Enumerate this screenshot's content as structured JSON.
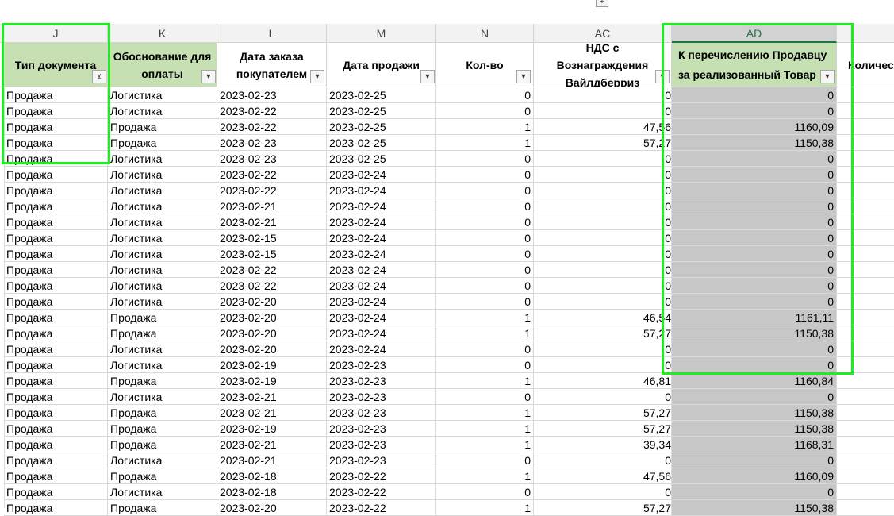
{
  "toolbar": {
    "expand_symbol": "+"
  },
  "columns": [
    {
      "letter": "J",
      "header": "Тип документа"
    },
    {
      "letter": "K",
      "header": "Обоснование для оплаты"
    },
    {
      "letter": "L",
      "header": "Дата заказа покупателем"
    },
    {
      "letter": "M",
      "header": "Дата продажи"
    },
    {
      "letter": "N",
      "header": "Кол-во"
    },
    {
      "letter": "AC",
      "header": "НДС с Вознаграждения Вайлдберриз"
    },
    {
      "letter": "AD",
      "header": "К перечислению Продавцу за реализованный Товар"
    },
    {
      "letter": "",
      "header": "Количес"
    }
  ],
  "filter_icon_active": "filter-active-icon",
  "filter_icon": "dropdown-arrow-icon",
  "colors": {
    "header_green": "#c6e0b4",
    "selection_gray": "#c7c7c7",
    "highlight_frame": "#1eee1e",
    "excel_green": "#217346"
  },
  "rows": [
    [
      "Продажа",
      "Логистика",
      "2023-02-23",
      "2023-02-25",
      "0",
      "0",
      "0"
    ],
    [
      "Продажа",
      "Логистика",
      "2023-02-22",
      "2023-02-25",
      "0",
      "0",
      "0"
    ],
    [
      "Продажа",
      "Продажа",
      "2023-02-22",
      "2023-02-25",
      "1",
      "47,56",
      "1160,09"
    ],
    [
      "Продажа",
      "Продажа",
      "2023-02-23",
      "2023-02-25",
      "1",
      "57,27",
      "1150,38"
    ],
    [
      "Продажа",
      "Логистика",
      "2023-02-23",
      "2023-02-25",
      "0",
      "0",
      "0"
    ],
    [
      "Продажа",
      "Логистика",
      "2023-02-22",
      "2023-02-24",
      "0",
      "0",
      "0"
    ],
    [
      "Продажа",
      "Логистика",
      "2023-02-22",
      "2023-02-24",
      "0",
      "0",
      "0"
    ],
    [
      "Продажа",
      "Логистика",
      "2023-02-21",
      "2023-02-24",
      "0",
      "0",
      "0"
    ],
    [
      "Продажа",
      "Логистика",
      "2023-02-21",
      "2023-02-24",
      "0",
      "0",
      "0"
    ],
    [
      "Продажа",
      "Логистика",
      "2023-02-15",
      "2023-02-24",
      "0",
      "0",
      "0"
    ],
    [
      "Продажа",
      "Логистика",
      "2023-02-15",
      "2023-02-24",
      "0",
      "0",
      "0"
    ],
    [
      "Продажа",
      "Логистика",
      "2023-02-22",
      "2023-02-24",
      "0",
      "0",
      "0"
    ],
    [
      "Продажа",
      "Логистика",
      "2023-02-22",
      "2023-02-24",
      "0",
      "0",
      "0"
    ],
    [
      "Продажа",
      "Логистика",
      "2023-02-20",
      "2023-02-24",
      "0",
      "0",
      "0"
    ],
    [
      "Продажа",
      "Продажа",
      "2023-02-20",
      "2023-02-24",
      "1",
      "46,54",
      "1161,11"
    ],
    [
      "Продажа",
      "Продажа",
      "2023-02-20",
      "2023-02-24",
      "1",
      "57,27",
      "1150,38"
    ],
    [
      "Продажа",
      "Логистика",
      "2023-02-20",
      "2023-02-24",
      "0",
      "0",
      "0"
    ],
    [
      "Продажа",
      "Логистика",
      "2023-02-19",
      "2023-02-23",
      "0",
      "0",
      "0"
    ],
    [
      "Продажа",
      "Продажа",
      "2023-02-19",
      "2023-02-23",
      "1",
      "46,81",
      "1160,84"
    ],
    [
      "Продажа",
      "Логистика",
      "2023-02-21",
      "2023-02-23",
      "0",
      "0",
      "0"
    ],
    [
      "Продажа",
      "Продажа",
      "2023-02-21",
      "2023-02-23",
      "1",
      "57,27",
      "1150,38"
    ],
    [
      "Продажа",
      "Продажа",
      "2023-02-19",
      "2023-02-23",
      "1",
      "57,27",
      "1150,38"
    ],
    [
      "Продажа",
      "Продажа",
      "2023-02-21",
      "2023-02-23",
      "1",
      "39,34",
      "1168,31"
    ],
    [
      "Продажа",
      "Логистика",
      "2023-02-21",
      "2023-02-23",
      "0",
      "0",
      "0"
    ],
    [
      "Продажа",
      "Продажа",
      "2023-02-18",
      "2023-02-22",
      "1",
      "47,56",
      "1160,09"
    ],
    [
      "Продажа",
      "Логистика",
      "2023-02-18",
      "2023-02-22",
      "0",
      "0",
      "0"
    ],
    [
      "Продажа",
      "Продажа",
      "2023-02-20",
      "2023-02-22",
      "1",
      "57,27",
      "1150,38"
    ]
  ]
}
